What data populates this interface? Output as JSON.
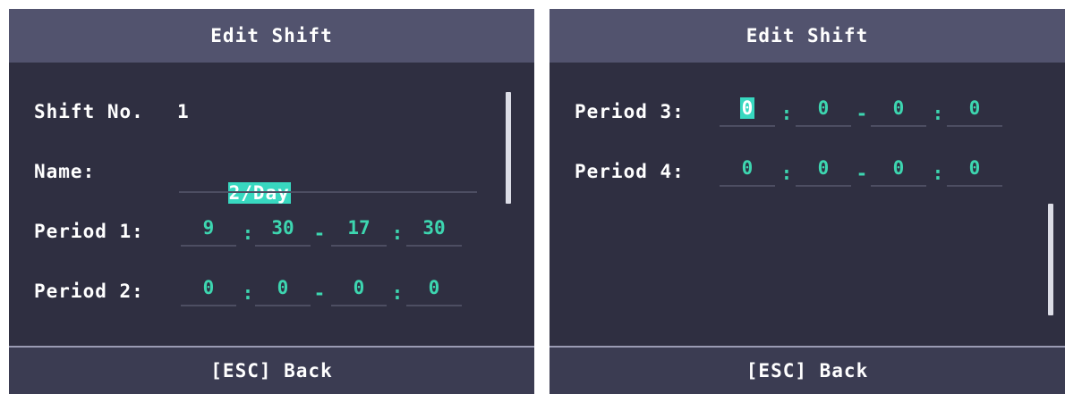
{
  "screens": [
    {
      "title": "Edit Shift",
      "footer": "[ESC] Back",
      "shift_no_label": "Shift No.",
      "shift_no_value": "1",
      "name_label": "Name:",
      "name_value": "2/Day",
      "periods": [
        {
          "label": "Period 1:",
          "start_h": "9",
          "start_m": "30",
          "end_h": "17",
          "end_m": "30"
        },
        {
          "label": "Period 2:",
          "start_h": "0",
          "start_m": "0",
          "end_h": "0",
          "end_m": "0"
        }
      ]
    },
    {
      "title": "Edit Shift",
      "footer": "[ESC] Back",
      "periods": [
        {
          "label": "Period 3:",
          "start_h": "0",
          "start_m": "0",
          "end_h": "0",
          "end_m": "0"
        },
        {
          "label": "Period 4:",
          "start_h": "0",
          "start_m": "0",
          "end_h": "0",
          "end_m": "0"
        }
      ]
    }
  ],
  "symbols": {
    "colon": ":",
    "dash": "-"
  },
  "colors": {
    "panel_bg": "#2f2f41",
    "title_bg": "#52536e",
    "value_color": "#3dd6b0",
    "highlight": "#38d8c0"
  }
}
